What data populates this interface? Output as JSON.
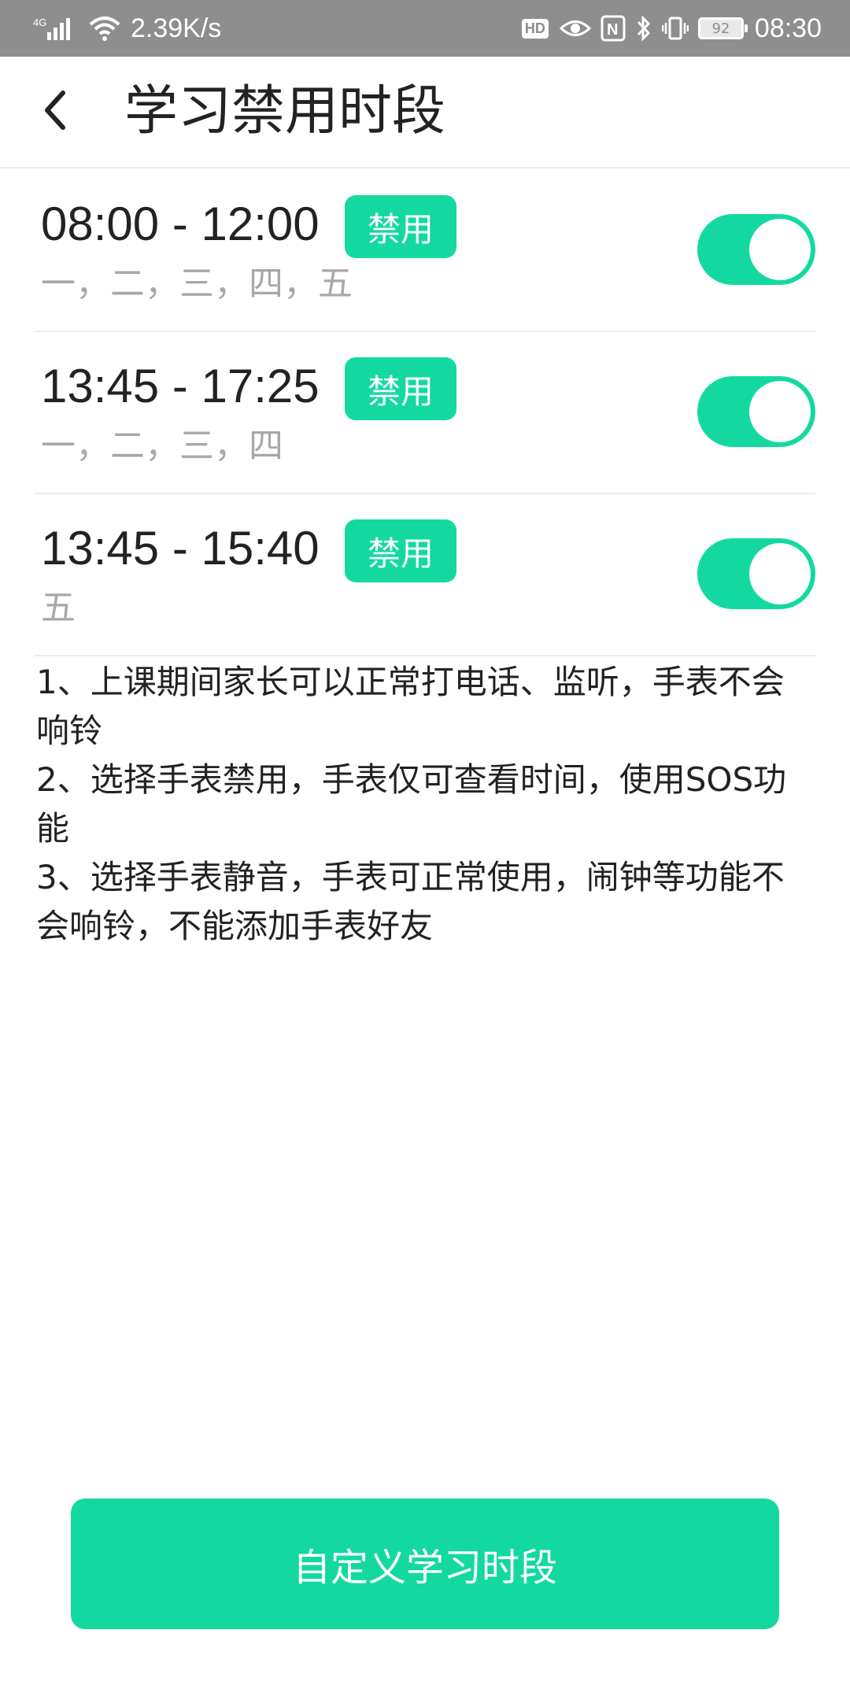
{
  "status_bar": {
    "network": "4G",
    "speed": "2.39K/s",
    "hd": "HD",
    "nfc": "N",
    "battery": "92",
    "time": "08:30"
  },
  "header": {
    "back_icon": "chevron-left-icon",
    "title": "学习禁用时段"
  },
  "schedules": [
    {
      "time": "08:00 - 12:00",
      "badge": "禁用",
      "days": "一，二，三，四，五",
      "enabled": true
    },
    {
      "time": "13:45 - 17:25",
      "badge": "禁用",
      "days": "一，二，三，四",
      "enabled": true
    },
    {
      "time": "13:45 - 15:40",
      "badge": "禁用",
      "days": "五",
      "enabled": true
    }
  ],
  "notes": [
    "1、上课期间家长可以正常打电话、监听，手表不会响铃",
    "2、选择手表禁用，手表仅可查看时间，使用SOS功能",
    "3、选择手表静音，手表可正常使用，闹钟等功能不会响铃，不能添加手表好友"
  ],
  "footer": {
    "custom_button": "自定义学习时段"
  },
  "colors": {
    "accent": "#13d9a0",
    "status_bar": "#8e8e8e"
  }
}
